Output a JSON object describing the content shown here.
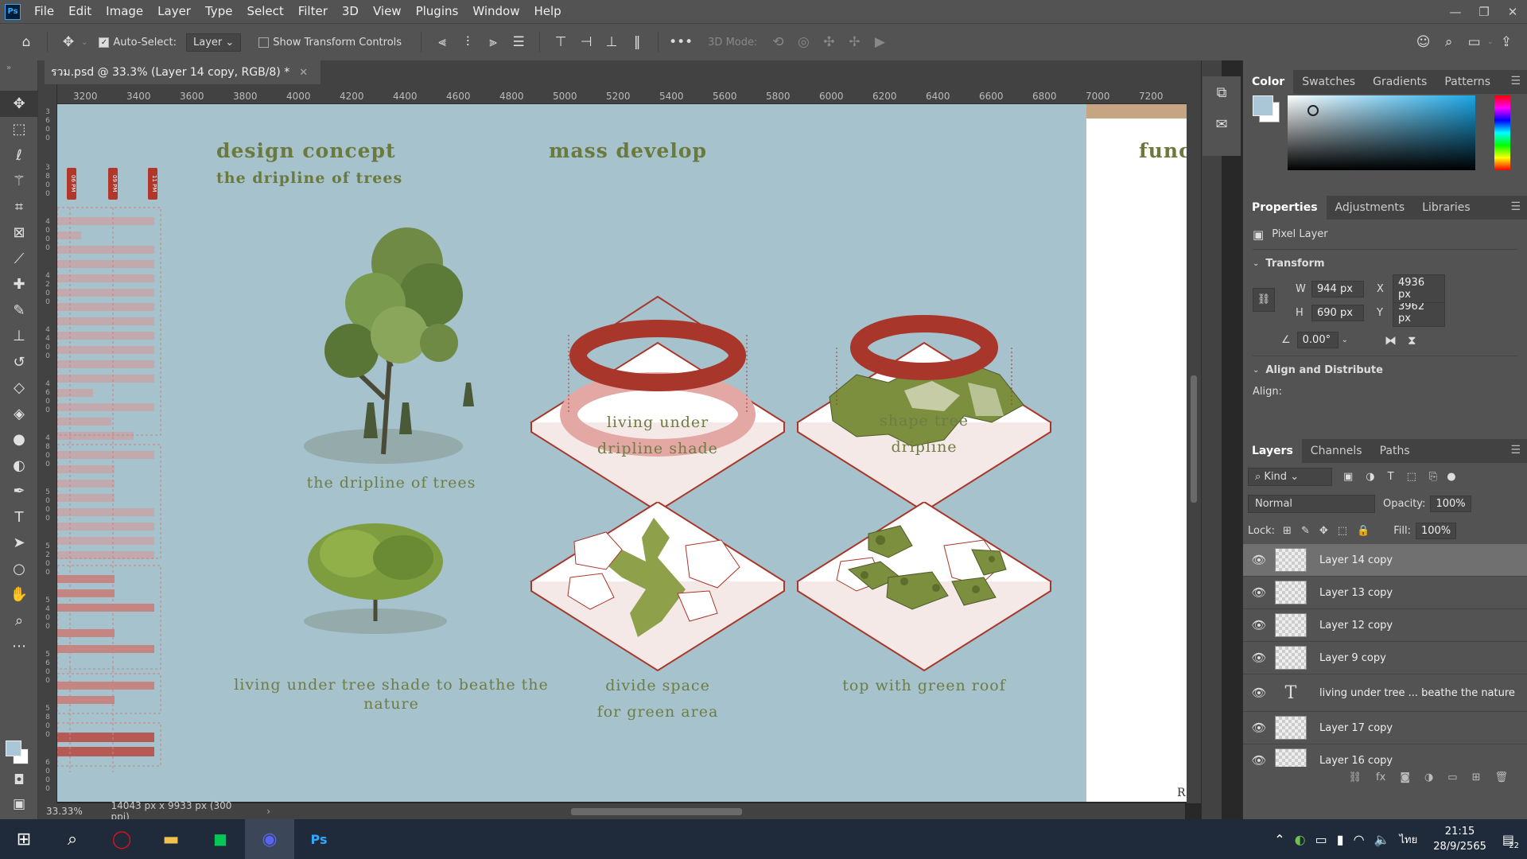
{
  "app": {
    "logo": "Ps"
  },
  "menu": [
    "File",
    "Edit",
    "Image",
    "Layer",
    "Type",
    "Select",
    "Filter",
    "3D",
    "View",
    "Plugins",
    "Window",
    "Help"
  ],
  "options": {
    "auto_select_label": "Auto-Select:",
    "auto_select_value": "Layer",
    "show_transform_label": "Show Transform Controls",
    "mode_3d_label": "3D Mode:",
    "more": "•••"
  },
  "document": {
    "tab_title": "รวม.psd @ 33.3% (Layer 14 copy, RGB/8) *",
    "zoom": "33.33%",
    "size_info": "14043 px x 9933 px (300 ppi)"
  },
  "ruler_top": [
    "3200",
    "3400",
    "3600",
    "3800",
    "4000",
    "4200",
    "4400",
    "4600",
    "4800",
    "5000",
    "5200",
    "5400",
    "5600",
    "5800",
    "6000",
    "6200",
    "6400",
    "6600",
    "6800",
    "7000",
    "7200"
  ],
  "canvas": {
    "titles": {
      "concept": "design concept",
      "concept_sub": "the dripline of trees",
      "mass": "mass develop",
      "func": "func"
    },
    "captions": {
      "tree1": "the dripline of trees",
      "tree2": "living under tree shade to beathe the nature",
      "diag1": "living under\ndripline shade",
      "diag2": "shape tree\ndripline",
      "diag3": "divide space\nfor green area",
      "diag4": "top with green roof"
    },
    "schedule_tags": [
      "06 PM",
      "09 PM",
      "11 PM"
    ],
    "corner_letter": "R"
  },
  "colors": {
    "artboard": "#a5c2cd",
    "red": "#a8362a",
    "green": "#7c8f3e",
    "title": "#6b7a3c"
  },
  "color_panel": {
    "tabs": [
      "Color",
      "Swatches",
      "Gradients",
      "Patterns"
    ]
  },
  "properties": {
    "tabs": [
      "Properties",
      "Adjustments",
      "Libraries"
    ],
    "layer_type": "Pixel Layer",
    "transform_title": "Transform",
    "w_label": "W",
    "w": "944 px",
    "h_label": "H",
    "h": "690 px",
    "x_label": "X",
    "x": "4936 px",
    "y_label": "Y",
    "y": "3962 px",
    "angle": "0.00°",
    "align_title": "Align and Distribute",
    "align_label": "Align:"
  },
  "layers_panel": {
    "tabs": [
      "Layers",
      "Channels",
      "Paths"
    ],
    "filter": "Kind",
    "blend": "Normal",
    "opacity_label": "Opacity:",
    "opacity": "100%",
    "lock_label": "Lock:",
    "fill_label": "Fill:",
    "fill": "100%",
    "layers": [
      {
        "name": "Layer 14 copy",
        "type": "pixel",
        "selected": true
      },
      {
        "name": "Layer 13 copy",
        "type": "pixel",
        "selected": false
      },
      {
        "name": "Layer 12 copy",
        "type": "pixel",
        "selected": false
      },
      {
        "name": "Layer 9 copy",
        "type": "pixel",
        "selected": false
      },
      {
        "name": "living under tree ... beathe the nature",
        "type": "text",
        "selected": false
      },
      {
        "name": "Layer 17 copy",
        "type": "pixel",
        "selected": false
      },
      {
        "name": "Layer 16 copy",
        "type": "pixel",
        "selected": false
      }
    ]
  },
  "taskbar": {
    "lang": "ไทย",
    "time": "21:15",
    "date": "28/9/2565",
    "notif": "22"
  }
}
